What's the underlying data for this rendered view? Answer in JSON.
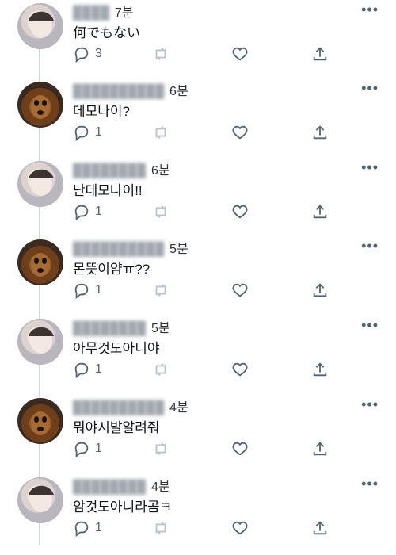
{
  "tweets": [
    {
      "author": "person",
      "time": "7분",
      "text": "何でもない",
      "reply_count": "3"
    },
    {
      "author": "dog",
      "time": "6분",
      "text": "데모나이?",
      "reply_count": "1"
    },
    {
      "author": "person",
      "time": "6분",
      "text": "난데모나이!!",
      "reply_count": "1"
    },
    {
      "author": "dog",
      "time": "5분",
      "text": "몬뜻이얌ㅠ??",
      "reply_count": "1"
    },
    {
      "author": "person",
      "time": "5분",
      "text": "아무것도아니야",
      "reply_count": "1"
    },
    {
      "author": "dog",
      "time": "4분",
      "text": "뭐야시발알려줘",
      "reply_count": "1"
    },
    {
      "author": "person",
      "time": "4분",
      "text": "암것도아니라곰ㅋ",
      "reply_count": "1"
    }
  ],
  "icons": {
    "more": "more-dots-icon",
    "reply": "reply-icon",
    "retweet": "retweet-icon",
    "like": "heart-icon",
    "share": "share-icon"
  },
  "colors": {
    "text": "#0f1419",
    "muted": "#536471",
    "thread_line": "#cfd6dc",
    "icon": "#536471",
    "retweet_disabled": "#b9c3cc"
  }
}
